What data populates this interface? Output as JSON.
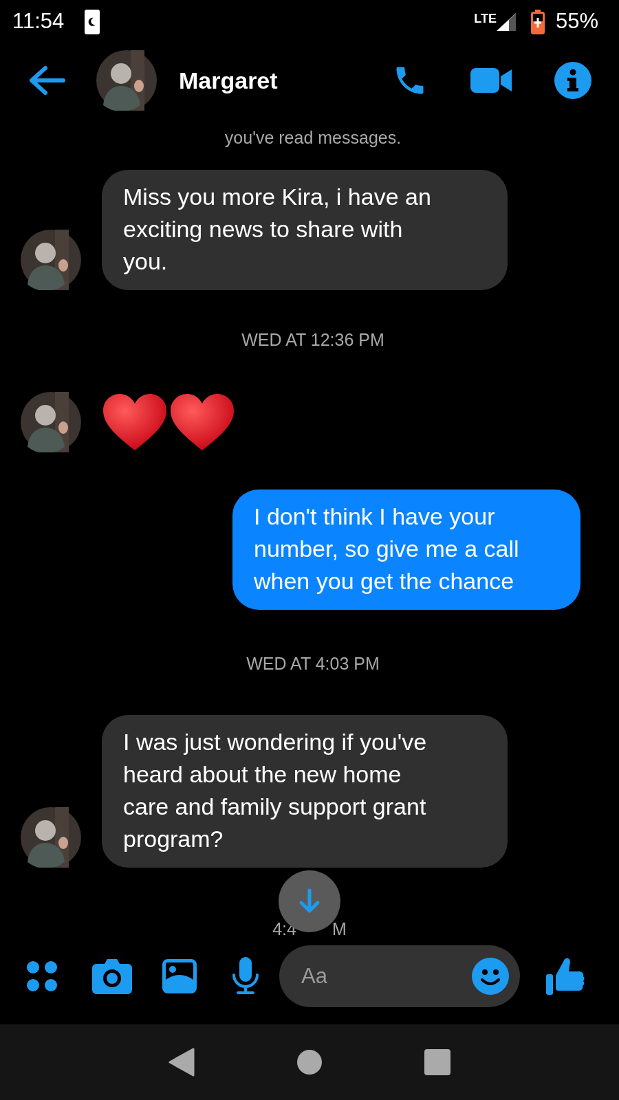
{
  "status_bar": {
    "time": "11:54",
    "network": "LTE",
    "battery": "55%"
  },
  "header": {
    "contact_name": "Margaret"
  },
  "notice": "you've read messages.",
  "messages": [
    {
      "kind": "incoming",
      "text": "Miss you more Kira, i have an exciting news to share with you."
    },
    {
      "kind": "timestamp",
      "text": "WED AT 12:36 PM"
    },
    {
      "kind": "emoji",
      "emojis": [
        {
          "kind": "heart"
        },
        {
          "kind": "heart"
        }
      ]
    },
    {
      "kind": "outgoing",
      "text": "I don't think I have your number, so give me a call when you get the chance"
    },
    {
      "kind": "timestamp",
      "text": "WED AT 4:03 PM"
    },
    {
      "kind": "incoming",
      "text": "I was just wondering if you've heard about the new home care and family support grant program?"
    }
  ],
  "covered_timestamp": {
    "before": "4:4",
    "after": "M"
  },
  "composer": {
    "placeholder": "Aa"
  }
}
